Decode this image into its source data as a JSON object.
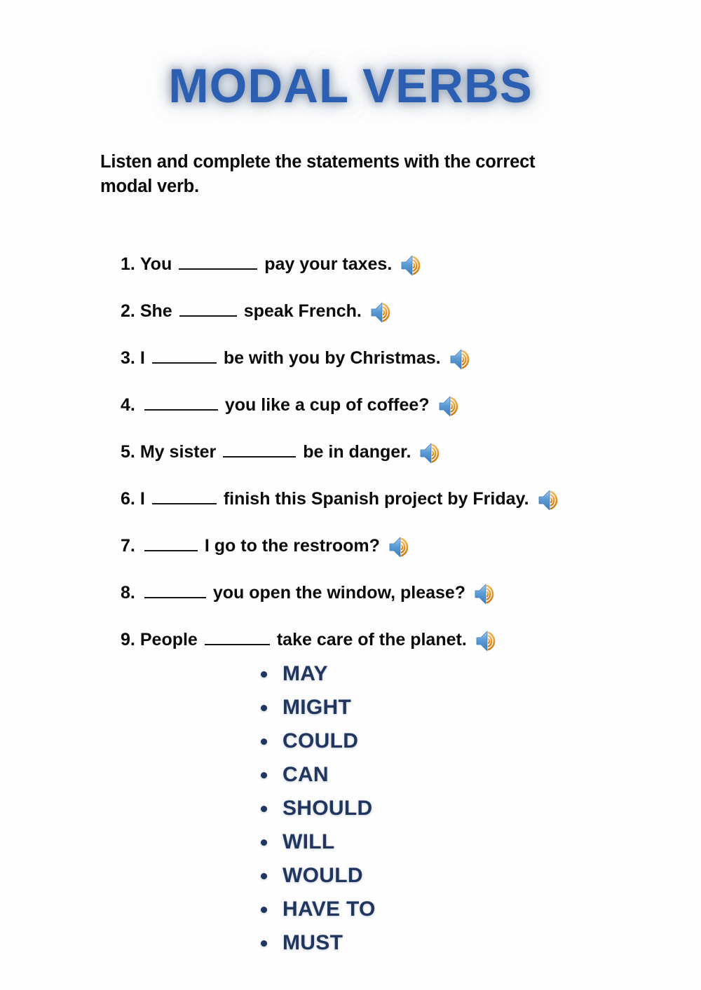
{
  "title": "MODAL VERBS",
  "instructions": "Listen and complete the statements with the correct modal verb.",
  "audio_icon": "speaker-icon",
  "colors": {
    "title_blue": "#2c5fb1",
    "title_glow": "#96a5b9",
    "wordbank_navy": "#20365e",
    "text_black": "#0b0b0b",
    "speaker_blue": "#5b9bd5",
    "speaker_orange": "#e8941f"
  },
  "questions": [
    {
      "number": "1.",
      "pre": "You",
      "blank": "_________",
      "post": "pay your taxes.",
      "blank_width": 112,
      "audio_label": "play-audio-1"
    },
    {
      "number": "2.",
      "pre": "She",
      "blank": "_______",
      "post": "speak French.",
      "blank_width": 82,
      "audio_label": "play-audio-2"
    },
    {
      "number": "3.",
      "pre": "I",
      "blank": "________",
      "post": "be with you by Christmas.",
      "blank_width": 92,
      "audio_label": "play-audio-3"
    },
    {
      "number": "4.",
      "pre": "",
      "blank": "_________",
      "post": "you like a cup of coffee?",
      "blank_width": 105,
      "audio_label": "play-audio-4"
    },
    {
      "number": "5.",
      "pre": "My sister",
      "blank": "_________",
      "post": "be in danger.",
      "blank_width": 104,
      "audio_label": "play-audio-5"
    },
    {
      "number": "6.",
      "pre": "I",
      "blank": "________",
      "post": "finish this Spanish project by Friday.",
      "blank_width": 92,
      "audio_label": "play-audio-6"
    },
    {
      "number": "7.",
      "pre": "",
      "blank": "______",
      "post": "I go to the restroom?",
      "blank_width": 76,
      "audio_label": "play-audio-7"
    },
    {
      "number": "8.",
      "pre": "",
      "blank": "_______",
      "post": "you open the window, please?",
      "blank_width": 88,
      "audio_label": "play-audio-8"
    },
    {
      "number": "9.",
      "pre": "People",
      "blank": "________",
      "post": "take care of the planet.",
      "blank_width": 93,
      "audio_label": "play-audio-9"
    }
  ],
  "word_bank": [
    {
      "label": "MAY"
    },
    {
      "label": "MIGHT"
    },
    {
      "label": "COULD"
    },
    {
      "label": "CAN"
    },
    {
      "label": "SHOULD"
    },
    {
      "label": "WILL"
    },
    {
      "label": "WOULD"
    },
    {
      "label": "HAVE TO"
    },
    {
      "label": "MUST"
    }
  ]
}
